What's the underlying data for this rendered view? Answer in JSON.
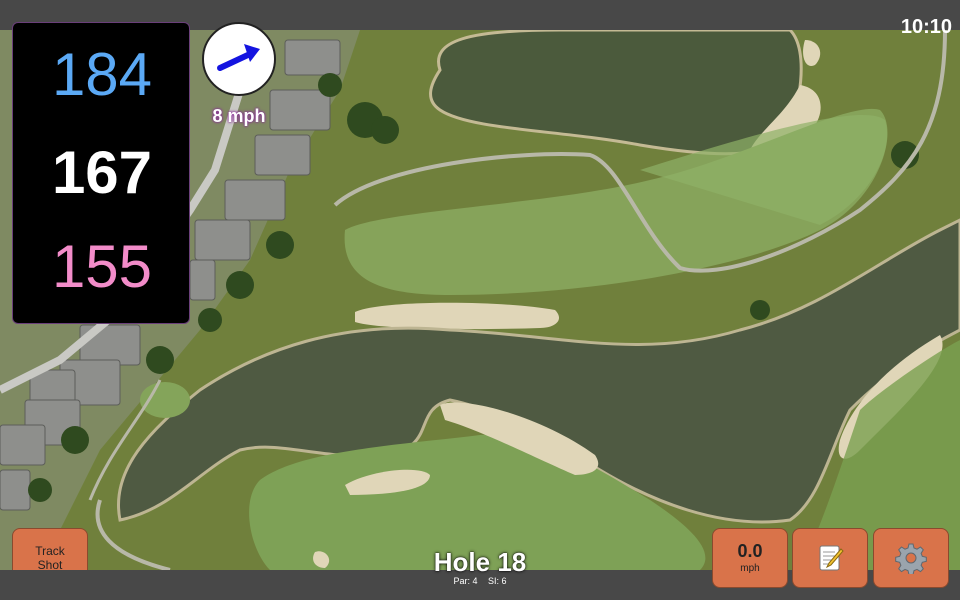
{
  "status": {
    "time": "10:10"
  },
  "distances": {
    "back": "184",
    "middle": "167",
    "front": "155"
  },
  "wind": {
    "speed": "8 mph",
    "icon": "wind-arrow-icon",
    "arrow_color": "#1414e0"
  },
  "hole": {
    "title": "Hole 18",
    "par": "Par: 4",
    "si": "SI: 6"
  },
  "buttons": {
    "track_shot": {
      "line1": "Track",
      "line2": "Shot"
    },
    "speed": {
      "value": "0.0",
      "unit": "mph"
    },
    "notes": {
      "icon": "notes-icon"
    },
    "settings": {
      "icon": "gear-icon"
    }
  },
  "colors": {
    "back_distance": "#5ba9f5",
    "middle_distance": "#ffffff",
    "front_distance": "#f28cc9",
    "button_bg": "#d9734a",
    "bar_bg": "#484848"
  }
}
